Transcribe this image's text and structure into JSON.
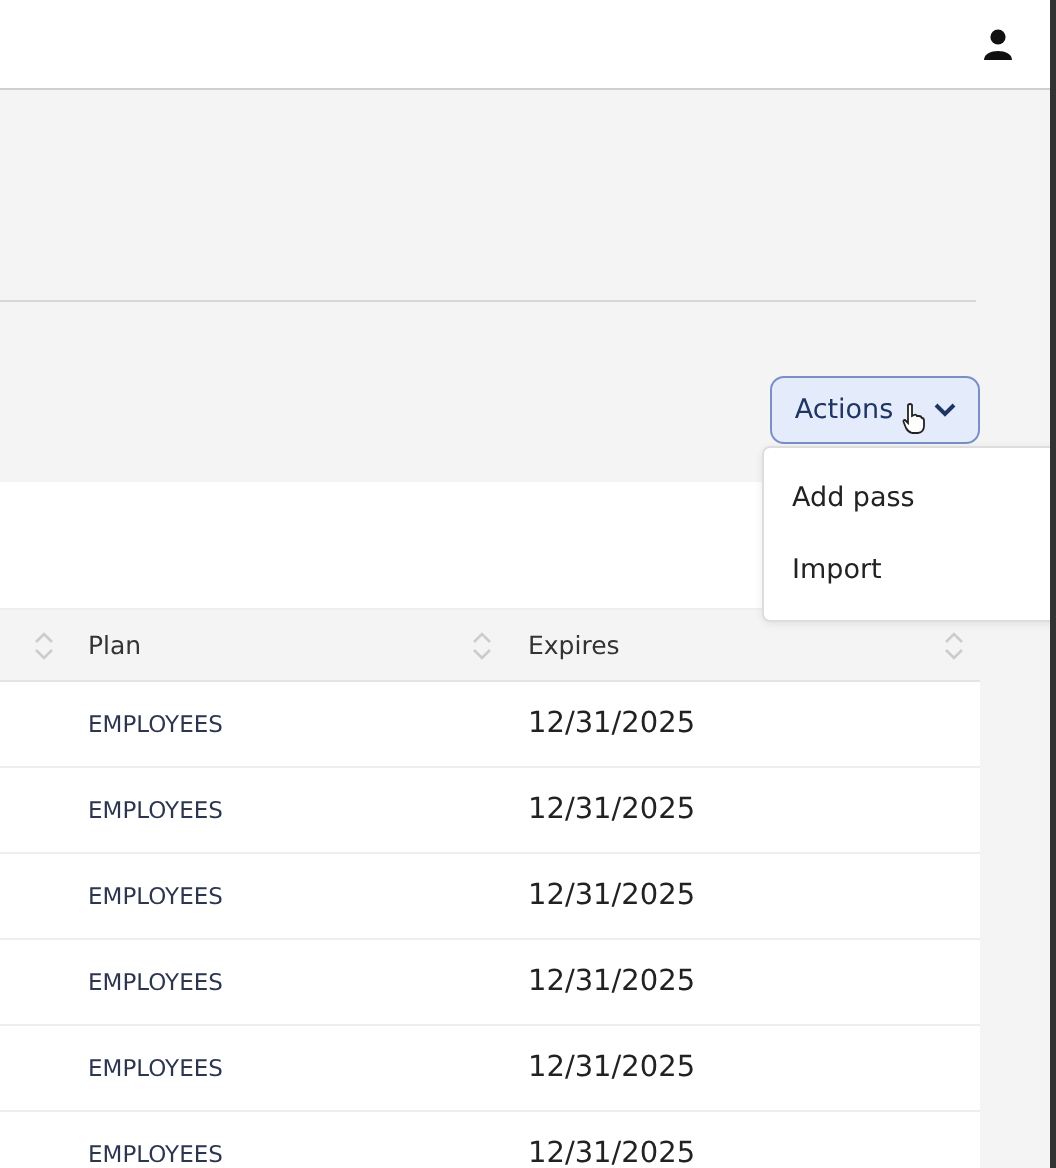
{
  "actions_button": {
    "label": "Actions",
    "expanded": true
  },
  "actions_menu": [
    {
      "label": "Add pass"
    },
    {
      "label": "Import"
    }
  ],
  "table": {
    "columns": [
      {},
      {
        "label": "Plan"
      },
      {
        "label": "Expires"
      }
    ],
    "rows": [
      {
        "plan": "EMPLOYEES",
        "expires": "12/31/2025"
      },
      {
        "plan": "EMPLOYEES",
        "expires": "12/31/2025"
      },
      {
        "plan": "EMPLOYEES",
        "expires": "12/31/2025"
      },
      {
        "plan": "EMPLOYEES",
        "expires": "12/31/2025"
      },
      {
        "plan": "EMPLOYEES",
        "expires": "12/31/2025"
      },
      {
        "plan": "EMPLOYEES",
        "expires": "12/31/2025"
      }
    ]
  }
}
